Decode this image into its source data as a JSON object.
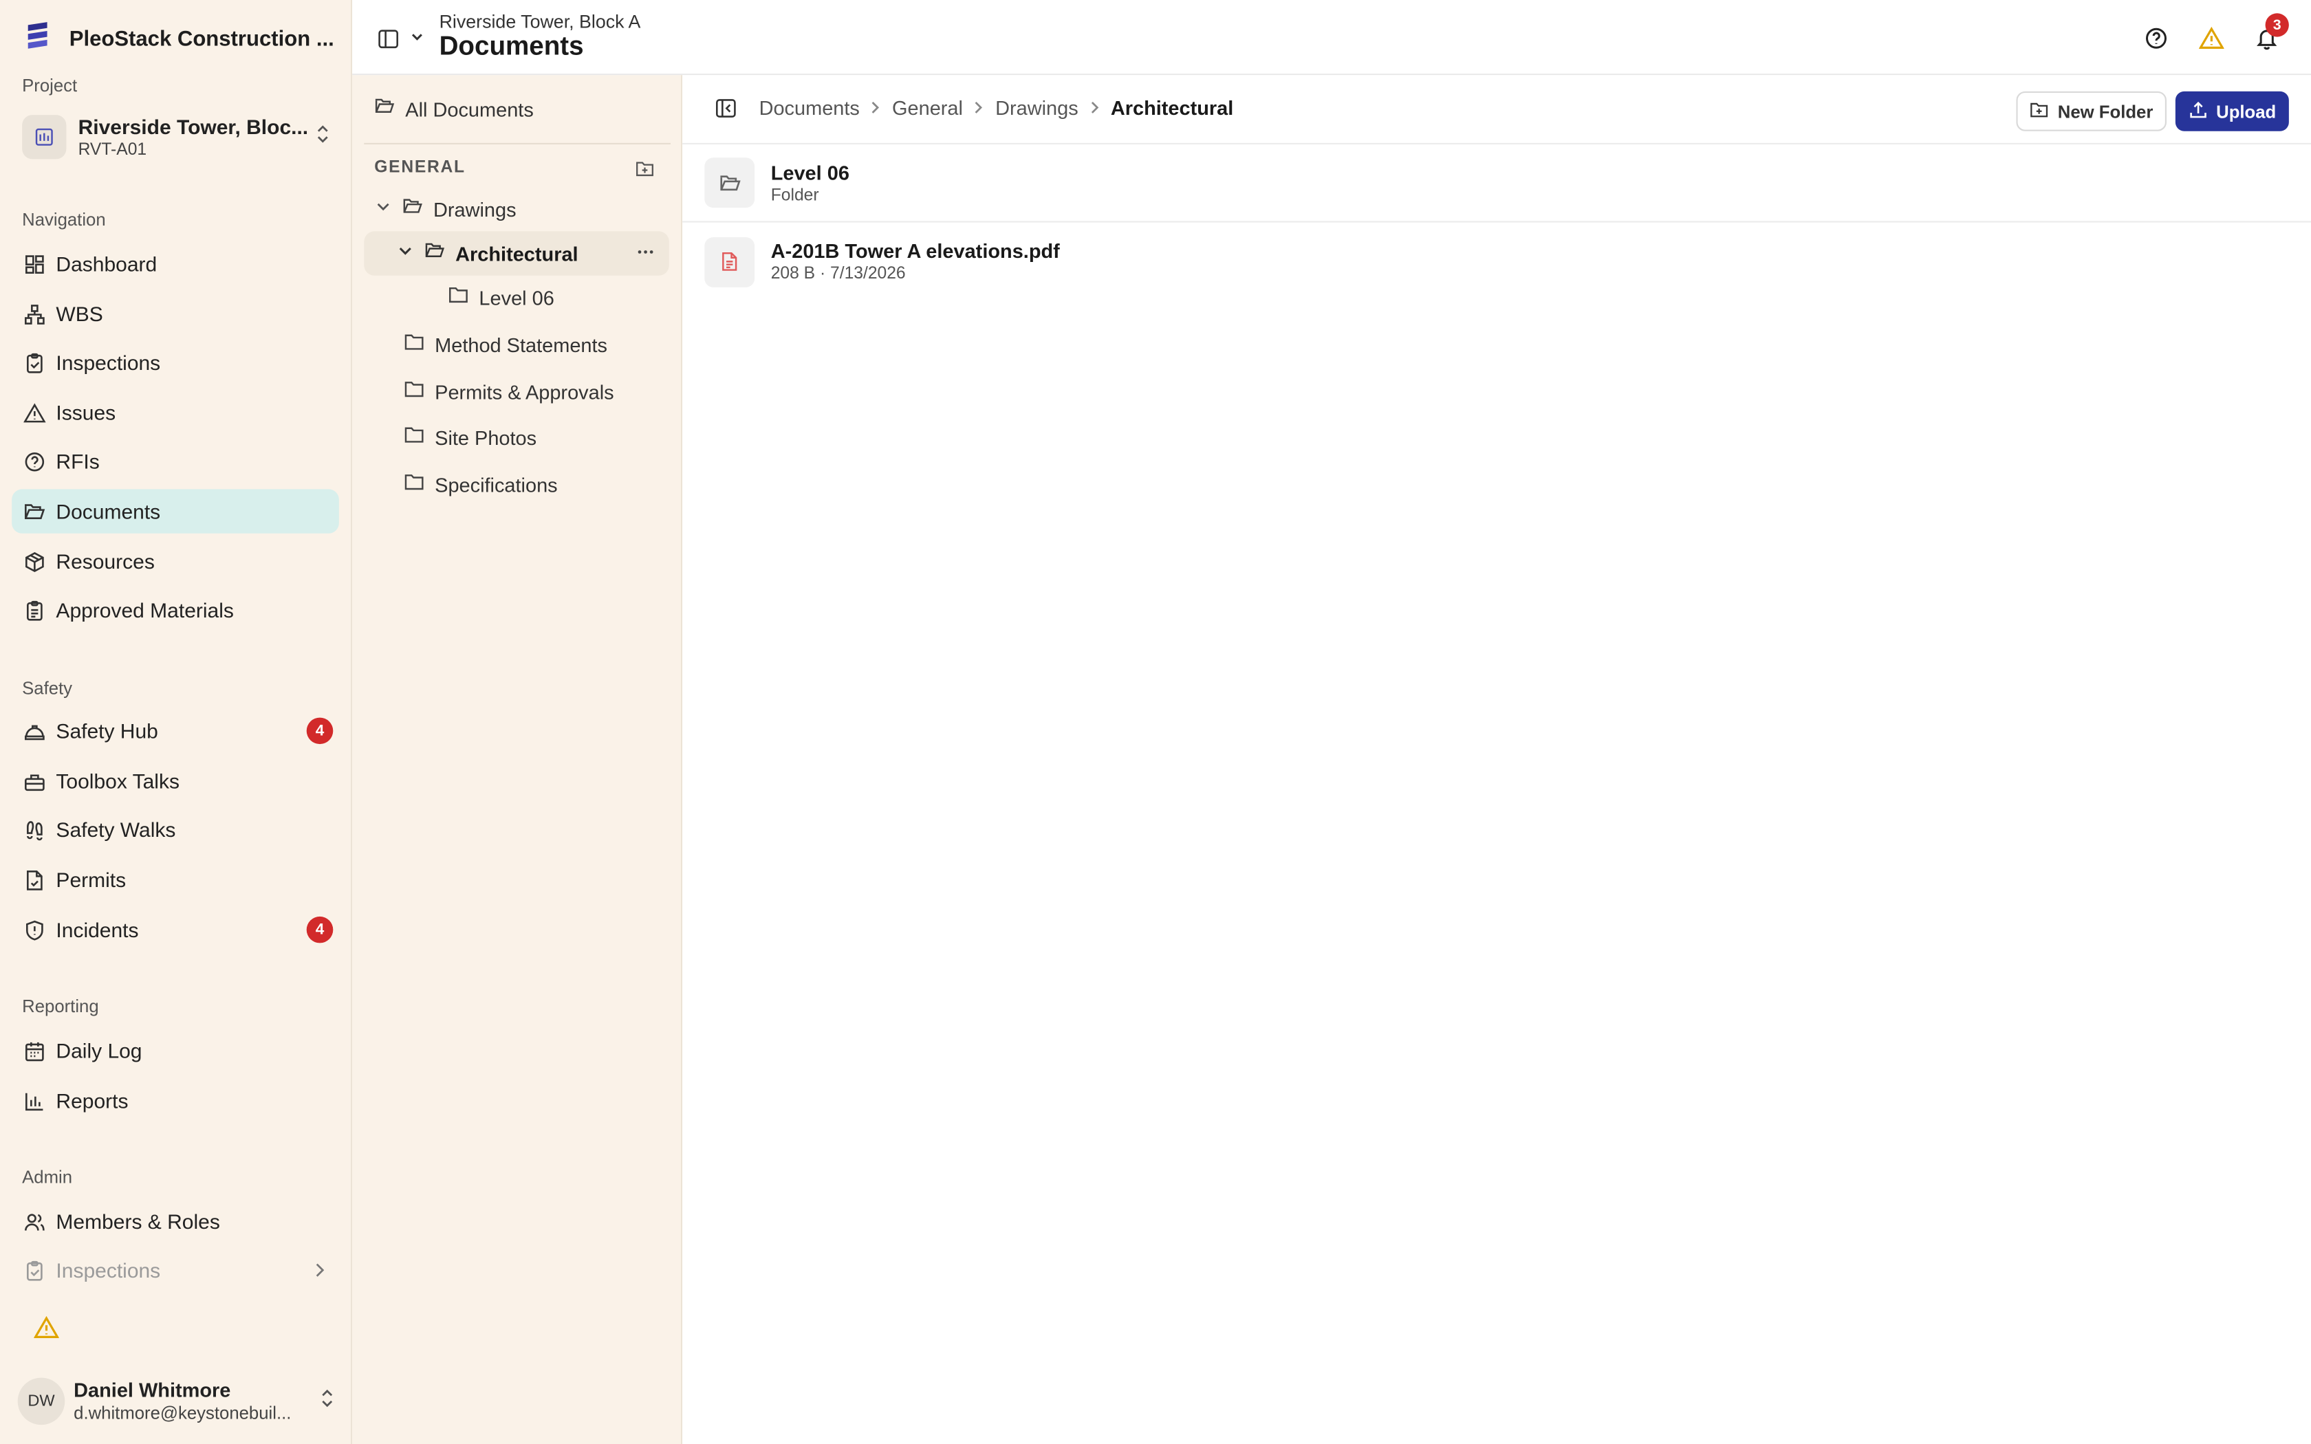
{
  "app": {
    "name": "PleoStack Construction ..."
  },
  "project": {
    "section_label": "Project",
    "name": "Riverside Tower, Bloc...",
    "code": "RVT-A01"
  },
  "sidebar": {
    "navigation_label": "Navigation",
    "navigation": [
      {
        "label": "Dashboard",
        "icon": "dashboard-icon"
      },
      {
        "label": "WBS",
        "icon": "hierarchy-icon"
      },
      {
        "label": "Inspections",
        "icon": "clipboard-check-icon"
      },
      {
        "label": "Issues",
        "icon": "warning-icon"
      },
      {
        "label": "RFIs",
        "icon": "question-circle-icon"
      },
      {
        "label": "Documents",
        "icon": "folder-open-icon",
        "active": true
      },
      {
        "label": "Resources",
        "icon": "package-icon"
      },
      {
        "label": "Approved Materials",
        "icon": "clipboard-list-icon"
      }
    ],
    "safety_label": "Safety",
    "safety": [
      {
        "label": "Safety Hub",
        "icon": "hard-hat-icon",
        "badge": "4"
      },
      {
        "label": "Toolbox Talks",
        "icon": "toolbox-icon"
      },
      {
        "label": "Safety Walks",
        "icon": "footprints-icon"
      },
      {
        "label": "Permits",
        "icon": "file-check-icon"
      },
      {
        "label": "Incidents",
        "icon": "shield-alert-icon",
        "badge": "4"
      }
    ],
    "reporting_label": "Reporting",
    "reporting": [
      {
        "label": "Daily Log",
        "icon": "calendar-icon"
      },
      {
        "label": "Reports",
        "icon": "bar-chart-icon"
      }
    ],
    "admin_label": "Admin",
    "admin": [
      {
        "label": "Members & Roles",
        "icon": "users-icon"
      },
      {
        "label": "Inspections",
        "icon": "clipboard-check-icon"
      }
    ]
  },
  "user": {
    "initials": "DW",
    "name": "Daniel Whitmore",
    "email": "d.whitmore@keystonebuil..."
  },
  "header": {
    "subtitle": "Riverside Tower, Block A",
    "title": "Documents",
    "notification_count": "3"
  },
  "tree": {
    "all_documents": "All Documents",
    "group_label": "GENERAL",
    "items": [
      {
        "label": "Drawings"
      },
      {
        "label": "Architectural"
      },
      {
        "label": "Level 06"
      },
      {
        "label": "Method Statements"
      },
      {
        "label": "Permits & Approvals"
      },
      {
        "label": "Site Photos"
      },
      {
        "label": "Specifications"
      }
    ]
  },
  "breadcrumb": [
    "Documents",
    "General",
    "Drawings",
    "Architectural"
  ],
  "actions": {
    "new_folder": "New Folder",
    "upload": "Upload"
  },
  "files": [
    {
      "name": "Level 06",
      "meta": "Folder",
      "type": "folder"
    },
    {
      "name": "A-201B Tower A elevations.pdf",
      "meta": "208 B · 7/13/2026",
      "type": "pdf"
    }
  ],
  "colors": {
    "accent": "#27349a",
    "active_nav": "#d8efec",
    "sidebar_bg": "#faf2e8",
    "badge": "#d22a2a",
    "warning": "#e0a400"
  }
}
